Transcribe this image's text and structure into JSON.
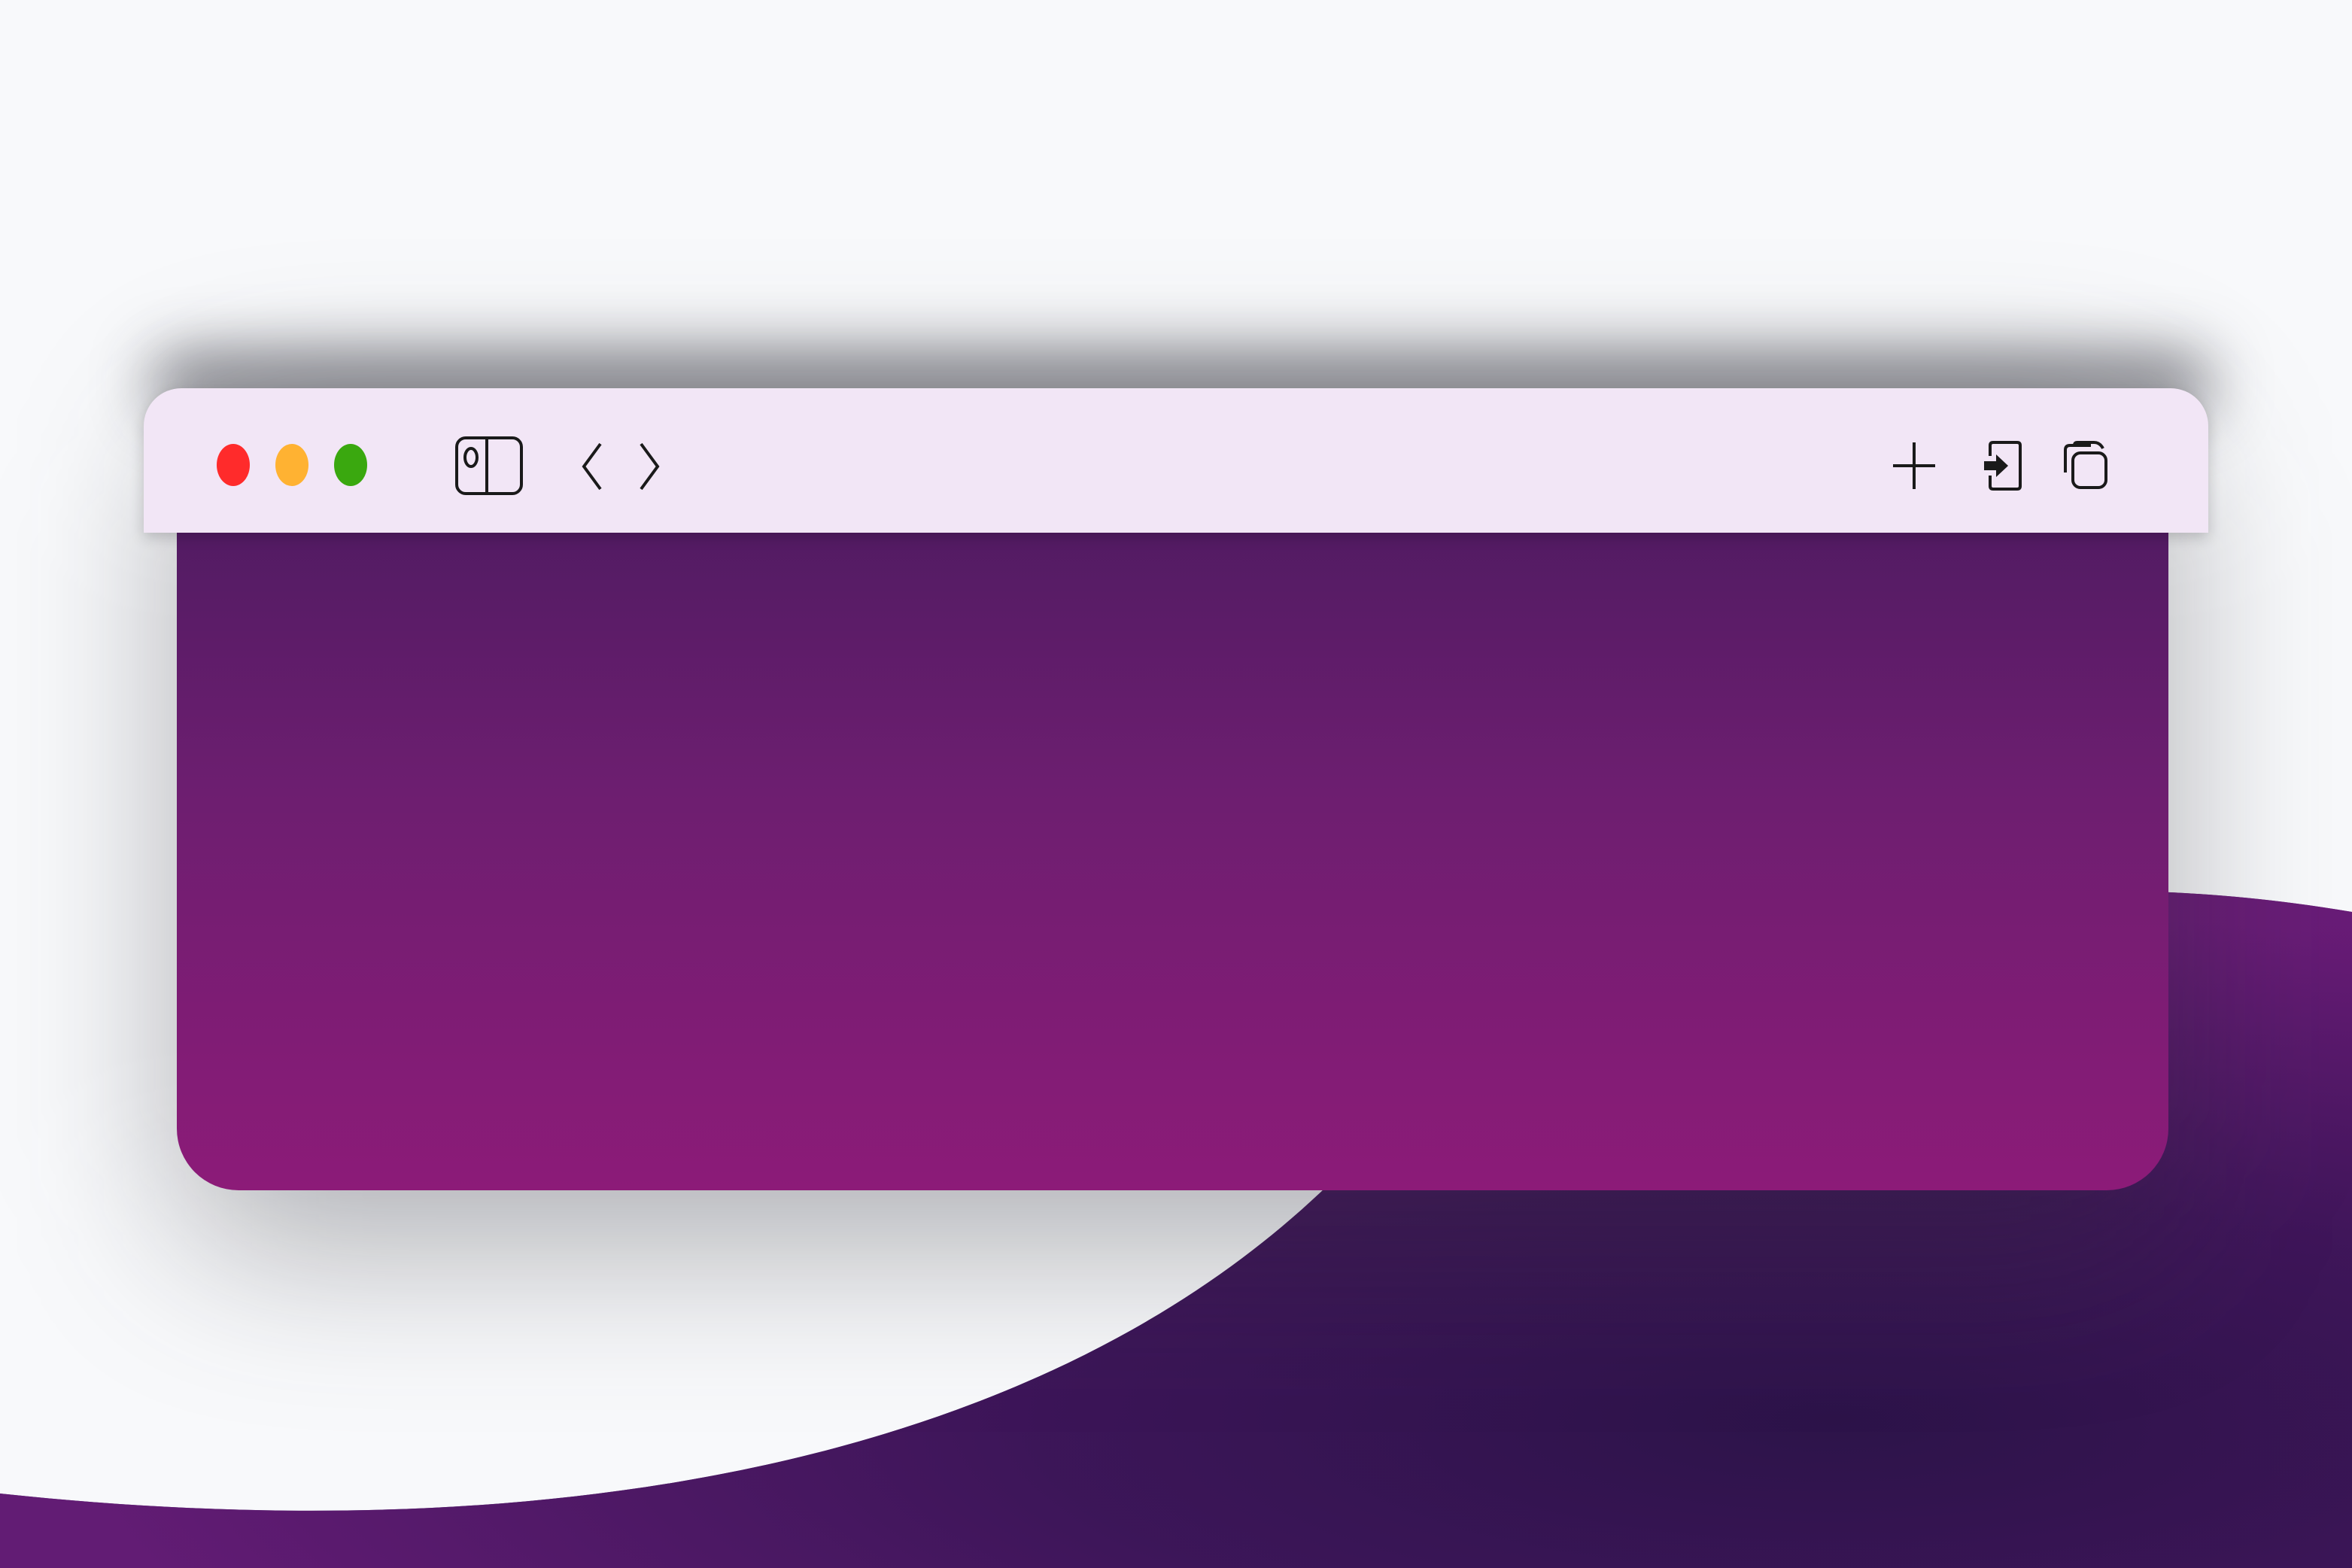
{
  "window": {
    "traffic_lights": [
      {
        "name": "close",
        "color": "#ff2b2b"
      },
      {
        "name": "minimize",
        "color": "#ffb232"
      },
      {
        "name": "maximize",
        "color": "#3aa80f"
      }
    ],
    "toolbar": {
      "background": "#f2e6f6",
      "left_icons": [
        "sidebar-toggle-icon",
        "back-icon",
        "forward-icon"
      ],
      "right_icons": [
        "new-tab-icon",
        "share-icon",
        "tab-overview-icon"
      ]
    },
    "content": {
      "gradient_top": "#521b63",
      "gradient_bottom": "#8c1b78"
    }
  },
  "colors": {
    "page_background": "#f8f9fb",
    "blob_dark": "#2e1650",
    "blob_light": "#6b1c78"
  }
}
